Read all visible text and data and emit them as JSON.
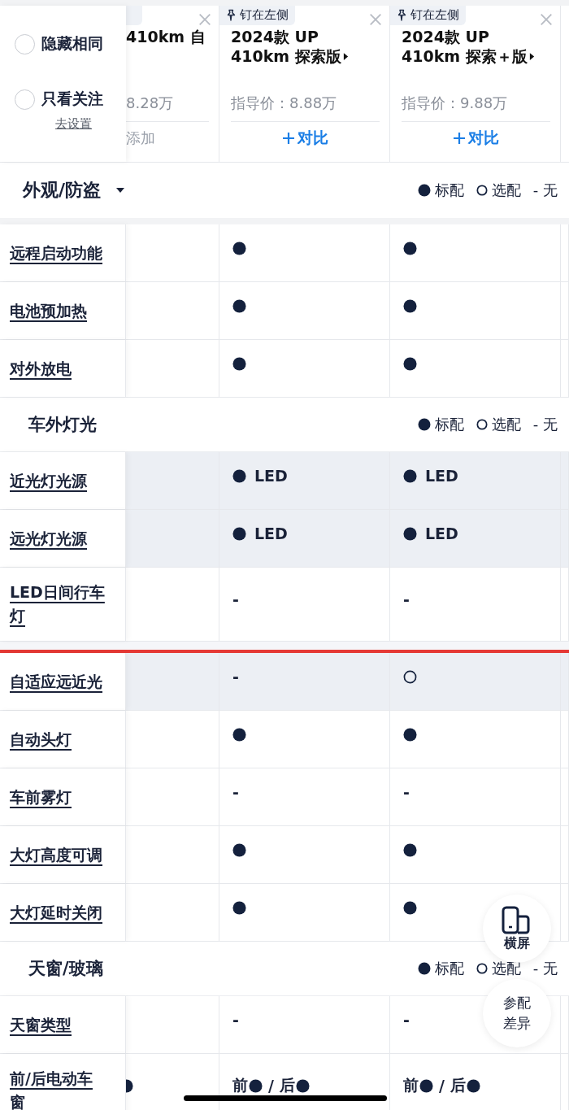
{
  "options": [
    {
      "label": "隐藏相同",
      "checked": false
    },
    {
      "label": "只看关注",
      "checked": false
    }
  ],
  "settings_link": "去设置",
  "cars": [
    {
      "kind": "partial",
      "name_lines": [
        "410km 自"
      ],
      "price": "8.28万",
      "action": "添加",
      "added": true
    },
    {
      "kind": "full",
      "pin": "钉在左侧",
      "name_lines": [
        "2024款 UP",
        "410km 探索版"
      ],
      "price": "指导价：8.88万",
      "action": "对比",
      "added": false
    },
    {
      "kind": "full",
      "pin": "钉在左侧",
      "name_lines": [
        "2024款 UP",
        "410km 探索＋版"
      ],
      "price": "指导价：9.88万",
      "action": "对比",
      "added": false
    }
  ],
  "sections": [
    {
      "title": "外观/防盗",
      "dropdown": true,
      "legend": {
        "std": "标配",
        "opt": "选配",
        "none_symbol": "-",
        "none": "无"
      },
      "rows": [
        {
          "label": "远程启动功能",
          "highlight": false,
          "cells": [
            {
              "kind": "blank"
            },
            {
              "kind": "std"
            },
            {
              "kind": "std"
            }
          ]
        },
        {
          "label": "电池预加热",
          "highlight": false,
          "cells": [
            {
              "kind": "blank"
            },
            {
              "kind": "std"
            },
            {
              "kind": "std"
            }
          ]
        },
        {
          "label": "对外放电",
          "highlight": false,
          "cells": [
            {
              "kind": "blank"
            },
            {
              "kind": "std"
            },
            {
              "kind": "std"
            }
          ]
        }
      ]
    },
    {
      "title": "车外灯光",
      "dropdown": false,
      "legend": {
        "std": "标配",
        "opt": "选配",
        "none_symbol": "-",
        "none": "无"
      },
      "rows": [
        {
          "label": "近光灯光源",
          "highlight": true,
          "cells": [
            {
              "kind": "blank"
            },
            {
              "kind": "std",
              "text": "LED"
            },
            {
              "kind": "std",
              "text": "LED"
            }
          ]
        },
        {
          "label": "远光灯光源",
          "highlight": true,
          "cells": [
            {
              "kind": "blank"
            },
            {
              "kind": "std",
              "text": "LED"
            },
            {
              "kind": "std",
              "text": "LED"
            }
          ]
        },
        {
          "label": "LED日间行车灯",
          "highlight": false,
          "red_line_after": true,
          "cells": [
            {
              "kind": "blank"
            },
            {
              "kind": "none",
              "text": "-"
            },
            {
              "kind": "none",
              "text": "-"
            }
          ]
        },
        {
          "label": "自适应远近光",
          "highlight": true,
          "cells": [
            {
              "kind": "blank"
            },
            {
              "kind": "none",
              "text": "-"
            },
            {
              "kind": "opt"
            }
          ]
        },
        {
          "label": "自动头灯",
          "highlight": false,
          "cells": [
            {
              "kind": "blank"
            },
            {
              "kind": "std"
            },
            {
              "kind": "std"
            }
          ]
        },
        {
          "label": "车前雾灯",
          "highlight": false,
          "cells": [
            {
              "kind": "blank"
            },
            {
              "kind": "none",
              "text": "-"
            },
            {
              "kind": "none",
              "text": "-"
            }
          ]
        },
        {
          "label": "大灯高度可调",
          "highlight": false,
          "cells": [
            {
              "kind": "blank"
            },
            {
              "kind": "std"
            },
            {
              "kind": "std"
            }
          ]
        },
        {
          "label": "大灯延时关闭",
          "highlight": false,
          "cells": [
            {
              "kind": "blank"
            },
            {
              "kind": "std"
            },
            {
              "kind": "std"
            }
          ]
        }
      ]
    },
    {
      "title": "天窗/玻璃",
      "dropdown": false,
      "legend": {
        "std": "标配",
        "opt": "选配",
        "none_symbol": "-",
        "none": "无"
      },
      "rows": [
        {
          "label": "天窗类型",
          "highlight": false,
          "cells": [
            {
              "kind": "blank"
            },
            {
              "kind": "none",
              "text": "-"
            },
            {
              "kind": "none",
              "text": "-"
            }
          ]
        },
        {
          "label": "前/后电动车窗",
          "highlight": false,
          "cells": [
            {
              "kind": "std"
            },
            {
              "kind": "split",
              "parts": [
                {
                  "label": "前",
                  "kind": "std"
                },
                {
                  "label": "后",
                  "kind": "std"
                }
              ],
              "separator": "/"
            },
            {
              "kind": "split",
              "parts": [
                {
                  "label": "前",
                  "kind": "std"
                },
                {
                  "label": "后",
                  "kind": "std"
                }
              ],
              "separator": "/"
            }
          ]
        }
      ]
    }
  ],
  "floating_buttons": [
    {
      "kind": "rotate",
      "label": "横屏"
    },
    {
      "kind": "diff",
      "label": "参配差异"
    }
  ]
}
